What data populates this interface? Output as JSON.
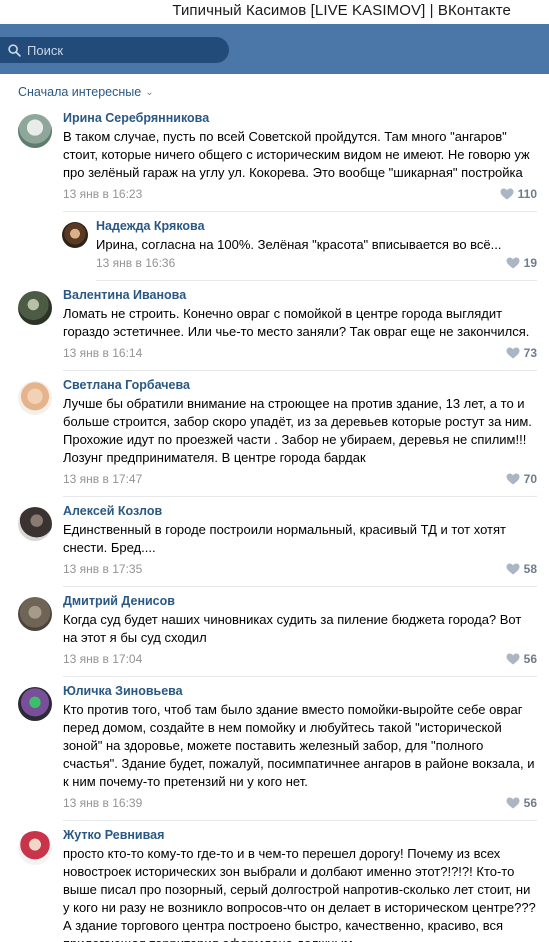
{
  "window": {
    "title": "Типичный Касимов [LIVE KASIMOV] | ВКонтакте"
  },
  "search": {
    "placeholder": "Поиск",
    "icon": "search-icon"
  },
  "sort": {
    "label": "Сначала интересные",
    "icon": "chevron-down-icon"
  },
  "colors": {
    "topbar": "#4a76a8",
    "search_bg": "#224b7a",
    "link": "#2a5885",
    "meta": "#939393"
  },
  "comments": [
    {
      "author": "Ирина Серебрянникова",
      "text": "В таком случае, пусть по всей Советской пройдутся. Там много \"ангаров\" стоит, которые ничего общего с историческим видом не имеют. Не говорю уж про зелёный гараж на углу ул. Кокорева. Это вообще \"шикарная\" постройка",
      "date": "13 янв в 16:23",
      "likes": "110",
      "reply": {
        "author": "Надежда Крякова",
        "text": "Ирина, согласна на 100%. Зелёная \"красота\" вписывается во всё...",
        "date": "13 янв в 16:36",
        "likes": "19"
      }
    },
    {
      "author": "Валентина Иванова",
      "text": "Ломать не строить. Конечно овраг с помойкой в центре города выглядит гораздо эстетичнее. Или чье-то место заняли? Так овраг еще не закончился.",
      "date": "13 янв в 16:14",
      "likes": "73"
    },
    {
      "author": "Светлана Горбачева",
      "text": "Лучше бы обратили внимание на строющее на против здание, 13 лет, а то и больше строится, забор скоро упадёт, из за деревьев которые ростут за ним. Прохожие идут по проезжей части . Забор не убираем, деревья не спилим!!! Лозунг предпринимателя. В центре города бардак",
      "date": "13 янв в 17:47",
      "likes": "70"
    },
    {
      "author": "Алексей Козлов",
      "text": "Единственный в городе построили нормальный, красивый ТД и тот хотят снести. Бред....",
      "date": "13 янв в 17:35",
      "likes": "58"
    },
    {
      "author": "Дмитрий Денисов",
      "text": "Когда суд будет наших чиновниках судить за пиление бюджета города? Вот на этот я бы суд сходил",
      "date": "13 янв в 17:04",
      "likes": "56"
    },
    {
      "author": "Юличка Зиновьева",
      "text": "Кто против того, чтоб там было здание вместо помойки-выройте себе овраг перед домом, создайте в нем помойку и любуйтесь такой \"исторической зоной\" на здоровье, можете поставить железный забор, для \"полного счастья\". Здание будет, пожалуй, посимпатичнее ангаров в районе вокзала, и к ним почему-то претензий ни у кого нет.",
      "date": "13 янв в 16:39",
      "likes": "56"
    },
    {
      "author": "Жутко Ревнивая",
      "text": "просто кто-то кому-то где-то и в чем-то перешел дорогу! Почему из всех новостроек исторических зон выбрали и долбают именно этот?!?!?! Кто-то выше писал про позорный, серый долгострой напротив-сколько лет стоит, ни у кого ни разу не возникло вопросов-что он делает в историческом центре??? А здание торгового центра построено быстро, качественно, красиво, вся прилегающая территория оформлена должным"
    }
  ]
}
